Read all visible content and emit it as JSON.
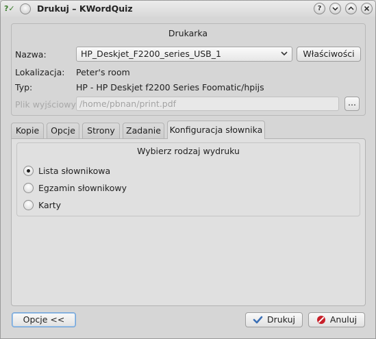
{
  "window": {
    "title": "Drukuj – KWordQuiz"
  },
  "printer": {
    "group_title": "Drukarka",
    "name_label": "Nazwa:",
    "name_value": "HP_Deskjet_F2200_series_USB_1",
    "properties_button": "Właściwości",
    "location_label": "Lokalizacja:",
    "location_value": "Peter's room",
    "type_label": "Typ:",
    "type_value": "HP - HP Deskjet f2200 Series Foomatic/hpijs",
    "output_file_label": "Plik wyjściowy:",
    "output_file_value": "/home/pbnan/print.pdf",
    "browse_button": "..."
  },
  "tabs": [
    {
      "label": "Kopie"
    },
    {
      "label": "Opcje"
    },
    {
      "label": "Strony"
    },
    {
      "label": "Zadanie"
    },
    {
      "label": "Konfiguracja słownika",
      "active": true
    }
  ],
  "print_type": {
    "title": "Wybierz rodzaj wydruku",
    "options": [
      {
        "label": "Lista słownikowa",
        "selected": true
      },
      {
        "label": "Egzamin słownikowy",
        "selected": false
      },
      {
        "label": "Karty",
        "selected": false
      }
    ]
  },
  "footer": {
    "options_button": "Opcje <<",
    "print_button": "Drukuj",
    "cancel_button": "Anuluj"
  },
  "colors": {
    "ok_check": "#3b6fb5",
    "cancel_icon": "#c8202a"
  },
  "icons": [
    "help-icon",
    "minimize-icon",
    "maximize-icon",
    "close-icon",
    "chevron-down-icon",
    "check-icon",
    "cancel-icon"
  ]
}
